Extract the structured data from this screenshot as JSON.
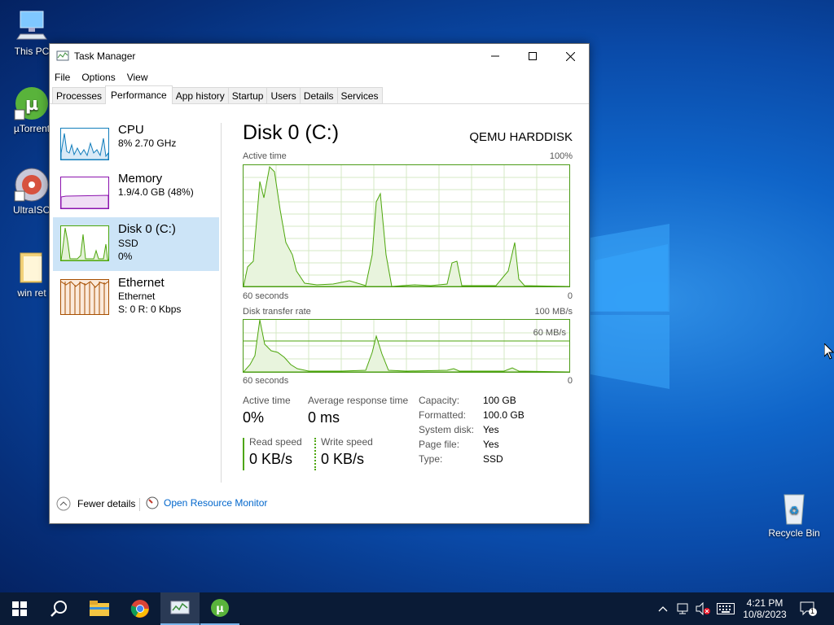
{
  "desktop": {
    "icons": [
      {
        "label": "This PC"
      },
      {
        "label": "µTorrent"
      },
      {
        "label": "UltraISO"
      },
      {
        "label": "win ret"
      },
      {
        "label": "Recycle Bin"
      }
    ]
  },
  "window": {
    "title": "Task Manager",
    "menu": [
      "File",
      "Options",
      "View"
    ],
    "tabs": [
      "Processes",
      "Performance",
      "App history",
      "Startup",
      "Users",
      "Details",
      "Services"
    ],
    "active_tab": "Performance"
  },
  "sidebar": [
    {
      "name": "CPU",
      "line1": "8% 2.70 GHz",
      "line2": "",
      "color": "#117dbb"
    },
    {
      "name": "Memory",
      "line1": "1.9/4.0 GB (48%)",
      "line2": "",
      "color": "#8b12ae"
    },
    {
      "name": "Disk 0 (C:)",
      "line1": "SSD",
      "line2": "0%",
      "color": "#4da60c"
    },
    {
      "name": "Ethernet",
      "line1": "Ethernet",
      "line2": "S: 0 R: 0 Kbps",
      "color": "#a74f01"
    }
  ],
  "detail": {
    "title": "Disk 0 (C:)",
    "model": "QEMU HARDDISK",
    "graph1": {
      "label": "Active time",
      "max": "100%",
      "left_axis": "60 seconds",
      "right_axis": "0"
    },
    "graph2": {
      "label": "Disk transfer rate",
      "max": "100 MB/s",
      "marker": "60 MB/s",
      "left_axis": "60 seconds",
      "right_axis": "0"
    },
    "stats": {
      "active_time_label": "Active time",
      "active_time_value": "0%",
      "avg_response_label": "Average response time",
      "avg_response_value": "0 ms",
      "read_label": "Read speed",
      "read_value": "0 KB/s",
      "write_label": "Write speed",
      "write_value": "0 KB/s"
    },
    "properties": [
      {
        "key": "Capacity:",
        "value": "100 GB"
      },
      {
        "key": "Formatted:",
        "value": "100.0 GB"
      },
      {
        "key": "System disk:",
        "value": "Yes"
      },
      {
        "key": "Page file:",
        "value": "Yes"
      },
      {
        "key": "Type:",
        "value": "SSD"
      }
    ]
  },
  "footer": {
    "fewer_details": "Fewer details",
    "resource_monitor": "Open Resource Monitor"
  },
  "taskbar": {
    "time": "4:21 PM",
    "date": "10/8/2023",
    "notification_count": "1"
  },
  "colors": {
    "disk_green": "#4da60c",
    "link_blue": "#0066cc",
    "taskbar": "#0a1b36"
  }
}
